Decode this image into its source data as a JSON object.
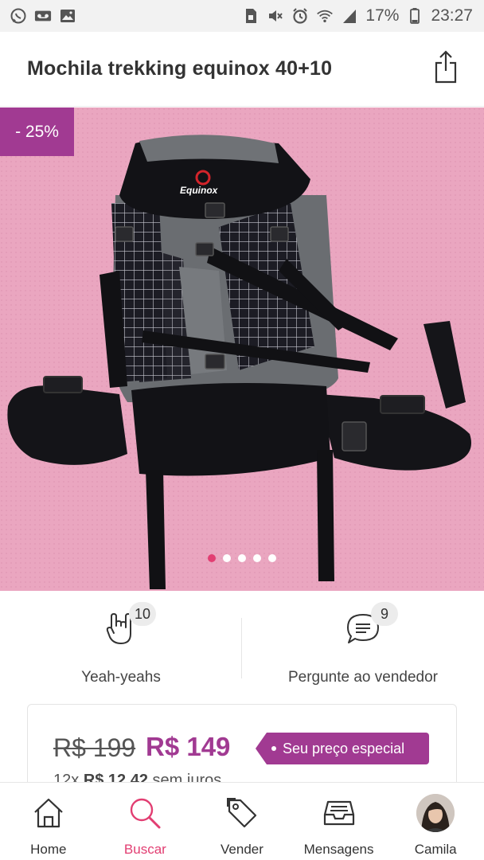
{
  "status_bar": {
    "left_icons": [
      "whatsapp-icon",
      "voicemail-icon",
      "image-icon"
    ],
    "right_icons": [
      "sim-icon",
      "mute-icon",
      "alarm-icon",
      "wifi-icon",
      "signal-icon",
      "battery-icon"
    ],
    "battery": "17%",
    "time": "23:27"
  },
  "header": {
    "title": "Mochila trekking equinox 40+10",
    "share_icon": "share-icon"
  },
  "gallery": {
    "discount_badge": "- 25%",
    "image_text": "Equinox",
    "slide_count": 5,
    "active_slide": 1
  },
  "actions": {
    "yeah": {
      "count": "10",
      "label": "Yeah-yeahs",
      "icon": "rock-hand-icon"
    },
    "ask": {
      "count": "9",
      "label": "Pergunte ao vendedor",
      "icon": "chat-bubble-icon"
    }
  },
  "pricing": {
    "old_price": "R$ 199",
    "new_price": "R$ 149",
    "special_tag": "Seu preço especial",
    "installments_prefix": "12x",
    "installments_value": "R$ 12,42",
    "installments_suffix": "sem juros"
  },
  "nav": {
    "items": [
      {
        "label": "Home",
        "icon": "home-icon"
      },
      {
        "label": "Buscar",
        "icon": "search-icon"
      },
      {
        "label": "Vender",
        "icon": "price-tag-icon"
      },
      {
        "label": "Mensagens",
        "icon": "inbox-icon"
      },
      {
        "label": "Camila",
        "icon": "avatar"
      }
    ],
    "active": "Buscar"
  },
  "colors": {
    "brand": "#a13a92",
    "accent": "#e23e72",
    "status_bar_bg": "#f2f2f2"
  }
}
